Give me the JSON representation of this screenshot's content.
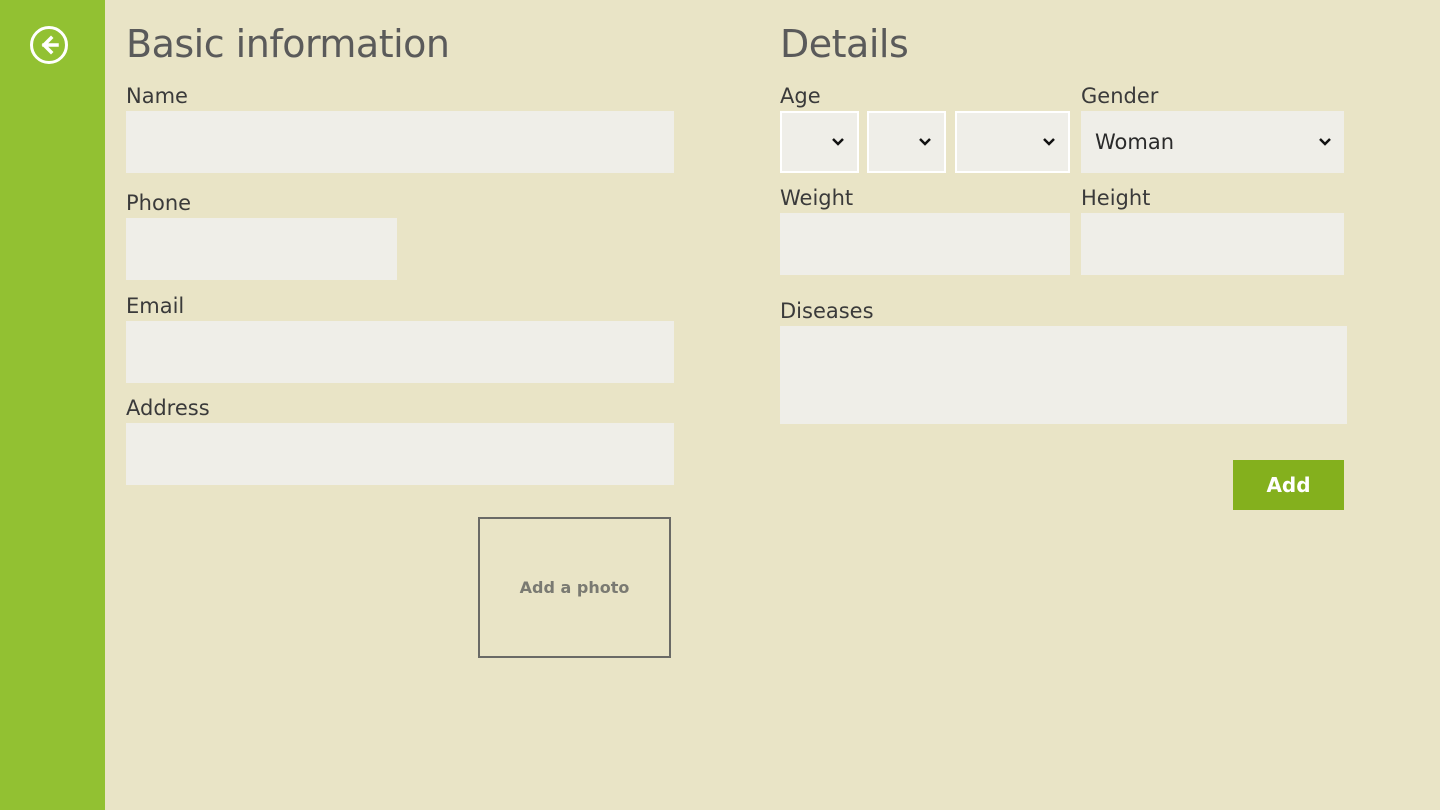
{
  "colors": {
    "sidebar": "#92c132",
    "background": "#e9e4c6",
    "accent_button": "#84b01d",
    "field": "#efeee8"
  },
  "nav": {
    "back_icon": "arrow-left-circle-icon"
  },
  "basic": {
    "title": "Basic information",
    "name_label": "Name",
    "name_value": "",
    "phone_label": "Phone",
    "phone_value": "",
    "email_label": "Email",
    "email_value": "",
    "address_label": "Address",
    "address_value": "",
    "photo_label": "Add a photo"
  },
  "details": {
    "title": "Details",
    "age_label": "Age",
    "age_day": "",
    "age_month": "",
    "age_year": "",
    "gender_label": "Gender",
    "gender_value": "Woman",
    "weight_label": "Weight",
    "weight_value": "",
    "height_label": "Height",
    "height_value": "",
    "diseases_label": "Diseases",
    "diseases_value": "",
    "add_label": "Add"
  }
}
